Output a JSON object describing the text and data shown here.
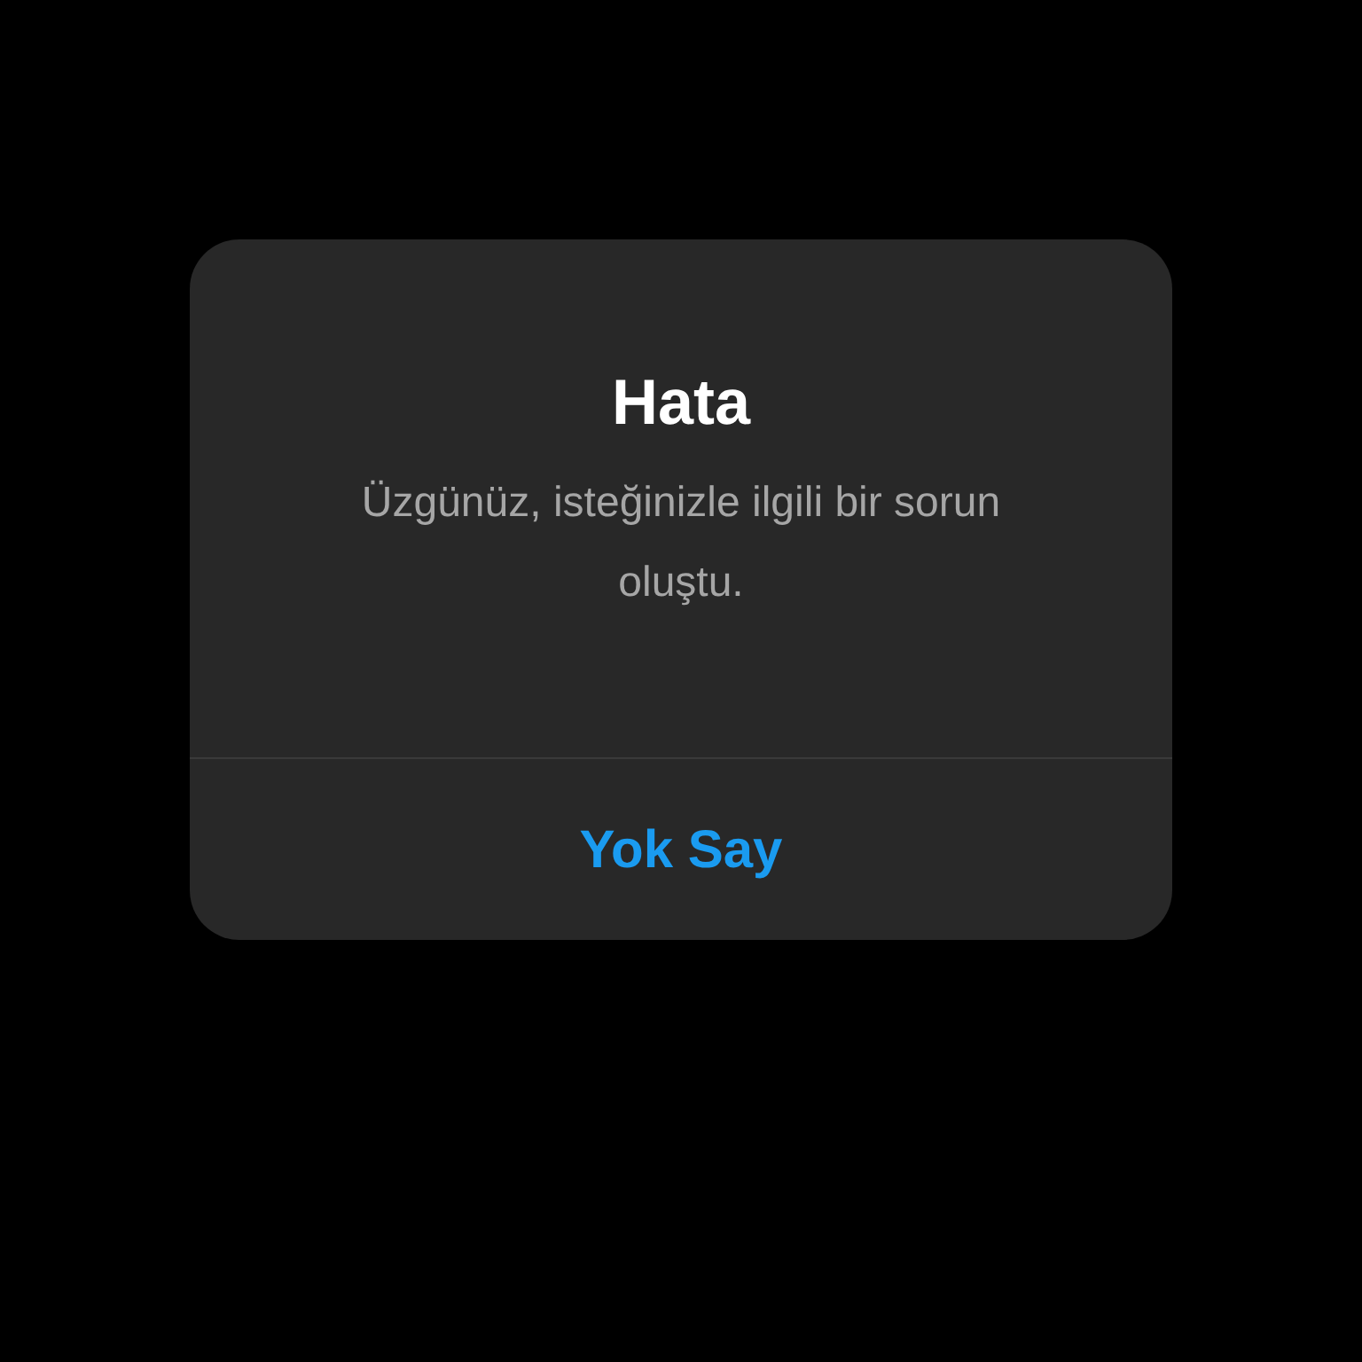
{
  "dialog": {
    "title": "Hata",
    "message": "Üzgünüz, isteğinizle ilgili bir sorun oluştu.",
    "buttons": [
      "Yok Say"
    ]
  }
}
